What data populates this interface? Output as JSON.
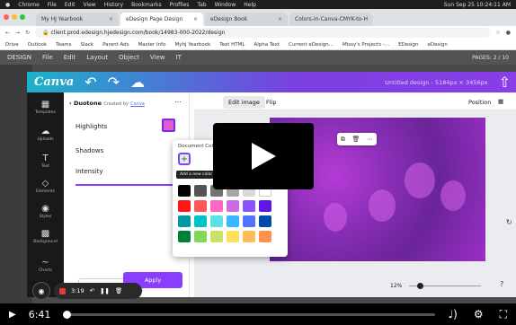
{
  "mac": {
    "menus": [
      "Chrome",
      "File",
      "Edit",
      "View",
      "History",
      "Bookmarks",
      "Profiles",
      "Tab",
      "Window",
      "Help"
    ],
    "clock": "Sun Sep 25  10:24:11 AM"
  },
  "tabs": [
    "My HJ Yearbook",
    "eDesign Page Design",
    "eDesign Book",
    "Colors-in-Canva-CMYK-to-H"
  ],
  "address": {
    "url": "client.prod.edesign.hjedesign.com/book/14983-000-2022/design"
  },
  "bookmarks": [
    "Drive",
    "Outlook",
    "Teams",
    "Slack",
    "Parent Ads",
    "Master Info",
    "Myhj Yearbook",
    "Text HTML",
    "Alpha Text",
    "Current eDesign...",
    "Missy's Projects -...",
    "EDesign",
    "eDesign"
  ],
  "indesign": {
    "menus": [
      "DESIGN",
      "File",
      "Edit",
      "Layout",
      "Object",
      "View",
      "IT"
    ],
    "pages": "PAGES: 2 / 10"
  },
  "canva": {
    "logo": "Canva",
    "doc_title": "Untitled design - 5184px × 3456px",
    "sidebar": [
      "Templates",
      "Uploads",
      "Text",
      "Elements",
      "Styles",
      "Background",
      "Charts"
    ],
    "panel": {
      "back": "‹ Duotone",
      "created": "Created by",
      "creator": "Canva",
      "highlights": "Highlights",
      "shadows": "Shadows",
      "intensity": "Intensity",
      "cancel": "Cancel",
      "apply": "Apply"
    },
    "toolbar": {
      "edit_image": "Edit image",
      "flip": "Flip",
      "position": "Position"
    },
    "popup": {
      "title": "Document Colors",
      "tooltip": "Add a new color"
    },
    "zoom": "12%"
  },
  "recorder": {
    "time": "3:19"
  },
  "video": {
    "time": "6:41",
    "progress": 0.0
  },
  "swatches": [
    "#000000",
    "#545454",
    "#737373",
    "#a6a6a6",
    "#d9d9d9",
    "#ffffff",
    "#ff1616",
    "#ff5757",
    "#ff66c4",
    "#cb6ce6",
    "#8c52ff",
    "#5e17eb",
    "#03989e",
    "#00c2cb",
    "#5ce1e6",
    "#38b6ff",
    "#5271ff",
    "#004aad",
    "#008037",
    "#7ed957",
    "#c9e265",
    "#ffde59",
    "#ffbd59",
    "#ff914d"
  ]
}
